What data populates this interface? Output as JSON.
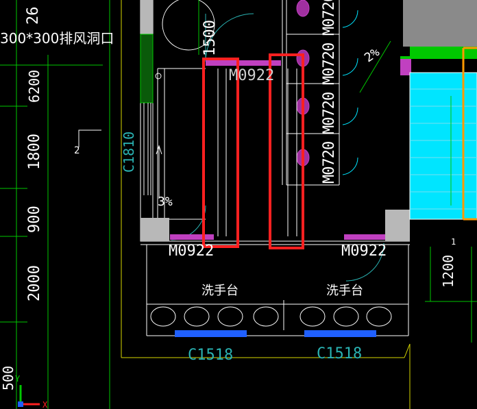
{
  "labels": {
    "vent": "300*300排风洞口",
    "dim_26": "26",
    "dim_6200": "6200",
    "dim_1800": "1800",
    "dim_900": "900",
    "dim_2000": "2000",
    "dim_500_left": "500",
    "dim_1500": "1500",
    "dim_1200": "1200",
    "mark_2": "2",
    "window_c1810": "C1810",
    "slope_left": "3%",
    "slope_right": "2%",
    "door_top": "M0922",
    "door_bl": "M0922",
    "door_br": "M0922",
    "door_m0720": "M0720",
    "sink_left": "洗手台",
    "sink_right": "洗手台",
    "window_bl": "C1518",
    "window_br": "C1518",
    "axis_y": "Y",
    "axis_x": "X",
    "mark_1": "1"
  },
  "colors": {
    "background": "#000000",
    "wall_line": "#ffffff",
    "dim_green": "#00c800",
    "annot_cyan": "#2ab3b3",
    "highlight_red": "#ff2020",
    "fixture_magenta": "#c040c0",
    "stair_cyan": "#00e5ff",
    "border_yellow": "#d8d800",
    "window_blue": "#2060ff",
    "accent_orange": "#ff9900"
  }
}
